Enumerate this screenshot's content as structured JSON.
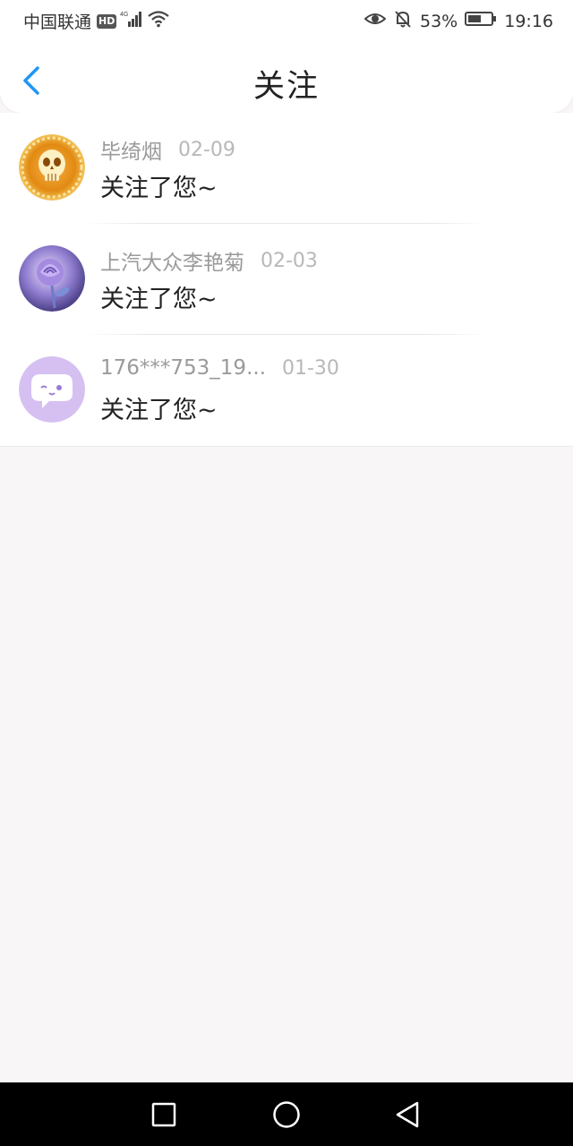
{
  "status_bar": {
    "carrier": "中国联通",
    "hd_badge": "HD",
    "network_type": "4G",
    "battery_percent": "53%",
    "time": "19:16",
    "icons": [
      "signal-icon",
      "wifi-icon",
      "eye-icon",
      "bell-off-icon",
      "battery-icon"
    ]
  },
  "nav": {
    "title": "关注",
    "back_icon": "chevron-left-icon"
  },
  "items": [
    {
      "name": "毕绮烟",
      "date": "02-09",
      "message": "关注了您~",
      "avatar": "skull-avatar"
    },
    {
      "name": "上汽大众李艳菊",
      "date": "02-03",
      "message": "关注了您~",
      "avatar": "rose-avatar"
    },
    {
      "name": "176***753_19...",
      "date": "01-30",
      "message": "关注了您~",
      "avatar": "chat-bubble-avatar"
    }
  ],
  "colors": {
    "accent": "#2196f3",
    "background": "#f8f6f7",
    "name_text": "#9a9a9a",
    "date_text": "#b8b8b8"
  },
  "system_nav": [
    "recent-apps-button",
    "home-button",
    "back-button"
  ]
}
